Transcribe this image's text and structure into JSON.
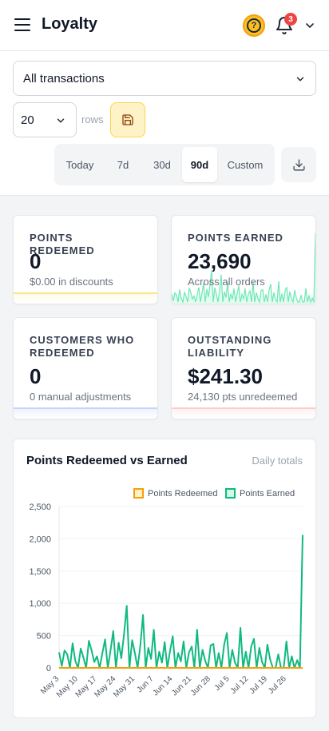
{
  "header": {
    "title": "Loyalty",
    "help_glyph": "?",
    "notification_count": "3",
    "icons": [
      "menu-icon",
      "help-icon",
      "bell-icon",
      "chevron-down-icon"
    ]
  },
  "filters": {
    "transaction_filter": "All transactions",
    "rows_value": "20",
    "rows_label": "rows",
    "ranges": [
      {
        "label": "Today"
      },
      {
        "label": "7d"
      },
      {
        "label": "30d"
      },
      {
        "label": "90d",
        "active": true
      },
      {
        "label": "Custom"
      }
    ],
    "icons": [
      "save-icon",
      "download-icon"
    ]
  },
  "cards": [
    {
      "label": "POINTS REDEEMED",
      "value": "0",
      "sub": "$0.00 in discounts",
      "accent": "#fbbf24"
    },
    {
      "label": "POINTS EARNED",
      "value": "23,690",
      "sub": "Across all orders",
      "accent": "#10b981"
    },
    {
      "label": "CUSTOMERS WHO REDEEMED",
      "value": "0",
      "sub": "0 manual adjustments",
      "accent": "#818cf8"
    },
    {
      "label": "OUTSTANDING LIABILITY",
      "value": "$241.30",
      "sub": "24,130 pts unredeemed",
      "accent": "#f87171"
    }
  ],
  "chart": {
    "title": "Points Redeemed vs Earned",
    "subtitle": "Daily totals"
  },
  "chart_data": {
    "type": "line",
    "x_tick_labels": [
      "May 3",
      "May 10",
      "May 17",
      "May 24",
      "May 31",
      "Jun 7",
      "Jun 14",
      "Jun 21",
      "Jun 28",
      "Jul 5",
      "Jul 12",
      "Jul 19",
      "Jul 26"
    ],
    "y_ticks": [
      0,
      500,
      1000,
      1500,
      2000,
      2500
    ],
    "ylim": [
      0,
      2500
    ],
    "grid": true,
    "legend_position": "top-right",
    "series": [
      {
        "name": "Points Redeemed",
        "color": "#f59e0b",
        "values": [
          0,
          0,
          0,
          0,
          0,
          0,
          0,
          0,
          0,
          0,
          0,
          0,
          0,
          0,
          0,
          0,
          0,
          0,
          0,
          0,
          0,
          0,
          0,
          0,
          0,
          0,
          0,
          0,
          0,
          0,
          0,
          0,
          0,
          0,
          0,
          0,
          0,
          0,
          0,
          0,
          0,
          0,
          0,
          0,
          0,
          0,
          0,
          0,
          0,
          0,
          0,
          0,
          0,
          0,
          0,
          0,
          0,
          0,
          0,
          0,
          0,
          0,
          0,
          0,
          0,
          0,
          0,
          0,
          0,
          0,
          0,
          0,
          0,
          0,
          0,
          0,
          0,
          0,
          0,
          0,
          0,
          0,
          0,
          0,
          0,
          0,
          0,
          0,
          0,
          0,
          0
        ]
      },
      {
        "name": "Points Earned",
        "color": "#10b981",
        "values": [
          240,
          30,
          270,
          210,
          0,
          380,
          110,
          0,
          300,
          160,
          0,
          420,
          270,
          90,
          180,
          0,
          230,
          440,
          0,
          270,
          570,
          0,
          390,
          150,
          520,
          960,
          0,
          430,
          230,
          0,
          340,
          820,
          0,
          310,
          140,
          590,
          0,
          250,
          80,
          400,
          0,
          260,
          490,
          0,
          230,
          100,
          410,
          0,
          240,
          330,
          0,
          590,
          0,
          280,
          110,
          0,
          350,
          370,
          0,
          230,
          0,
          360,
          540,
          0,
          280,
          80,
          0,
          620,
          0,
          250,
          0,
          330,
          450,
          0,
          310,
          90,
          0,
          360,
          130,
          0,
          0,
          210,
          0,
          0,
          410,
          0,
          180,
          0,
          120,
          0,
          2060
        ]
      }
    ]
  }
}
